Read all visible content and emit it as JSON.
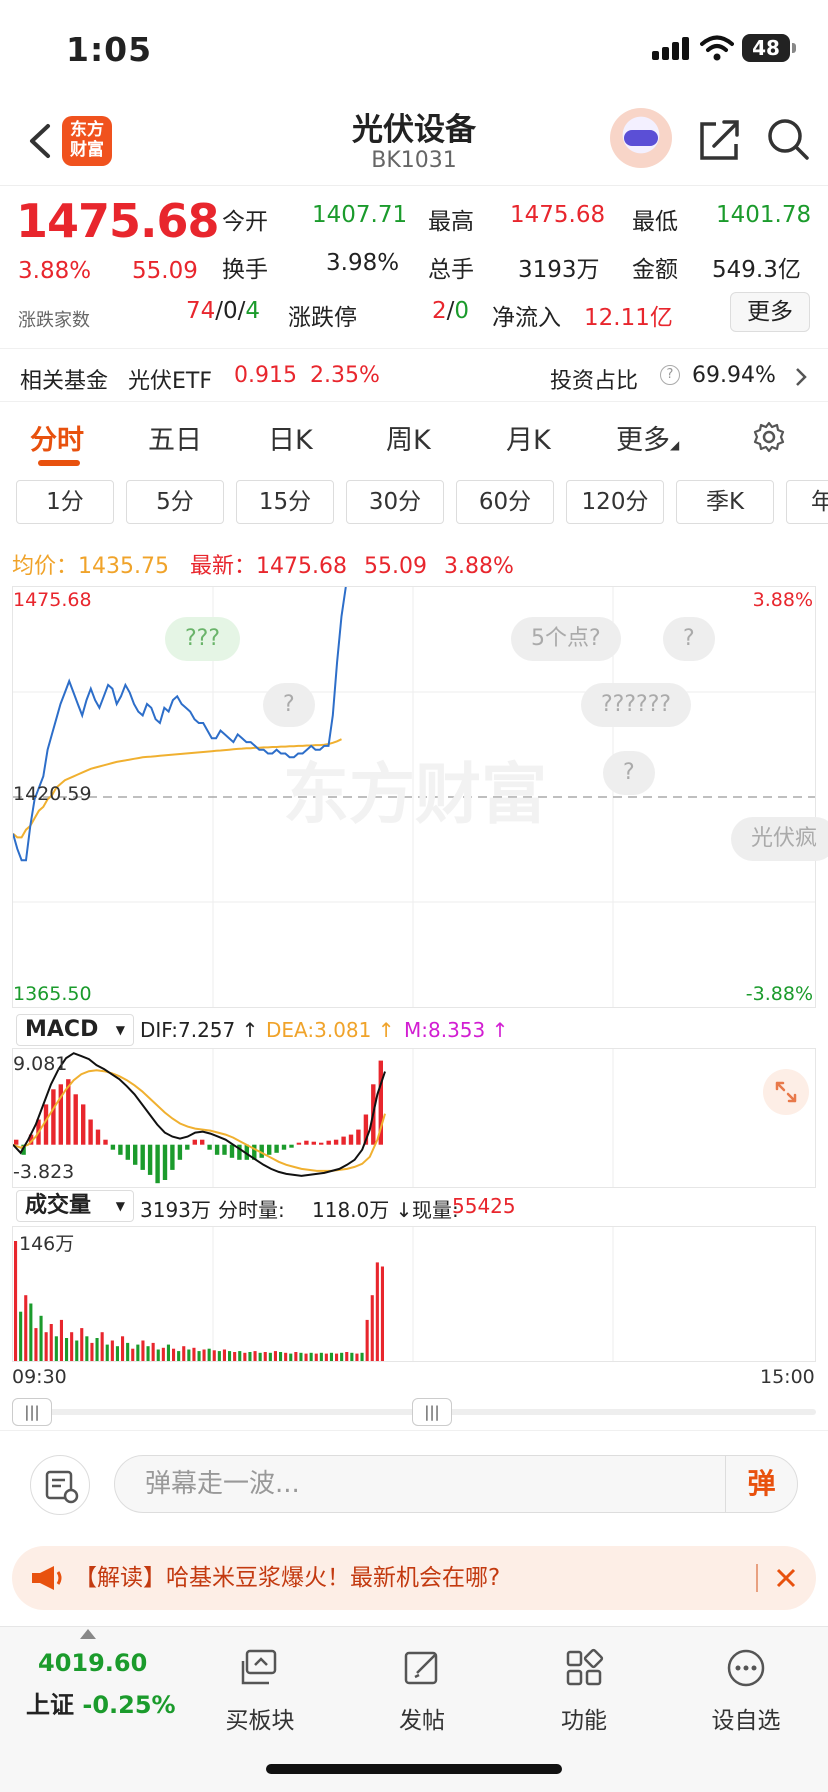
{
  "status": {
    "time": "1:05",
    "battery": "48"
  },
  "header": {
    "logo_text": "东方财富",
    "title": "光伏设备",
    "code": "BK1031"
  },
  "quote": {
    "price": "1475.68",
    "change_pct": "3.88%",
    "change": "55.09",
    "open_label": "今开",
    "open": "1407.71",
    "high_label": "最高",
    "high": "1475.68",
    "low_label": "最低",
    "low": "1401.78",
    "turnover_label": "换手",
    "turnover": "3.98%",
    "vol_label": "总手",
    "vol": "3193万",
    "amount_label": "金额",
    "amount": "549.3亿",
    "breadth_label": "涨跌家数",
    "up": "74",
    "flat": "0",
    "down": "4",
    "limit_label": "涨跌停",
    "limit_up": "2",
    "limit_down": "0",
    "inflow_label": "净流入",
    "inflow": "12.11亿",
    "more": "更多"
  },
  "fund": {
    "label": "相关基金",
    "name": "光伏ETF",
    "price": "0.915",
    "pct": "2.35%",
    "ratio_label": "投资占比",
    "ratio": "69.94%"
  },
  "tabs": [
    "分时",
    "五日",
    "日K",
    "周K",
    "月K",
    "更多"
  ],
  "periods": [
    "1分",
    "5分",
    "15分",
    "30分",
    "60分",
    "120分",
    "季K",
    "年"
  ],
  "avg": {
    "avg_label": "均价：",
    "avg": "1435.75",
    "latest_label": "最新：",
    "latest": "1475.68",
    "chg": "55.09",
    "pct": "3.88%"
  },
  "chart_data": {
    "type": "line",
    "y_top": "1475.68",
    "y_mid": "1420.59",
    "y_bottom": "1365.50",
    "pct_top": "3.88%",
    "pct_bottom": "-3.88%",
    "ylim": [
      1365.5,
      1475.68
    ],
    "x_start": "09:30",
    "x_end": "15:00",
    "series": [
      {
        "values": [
          1411,
          1407,
          1404,
          1404,
          1413,
          1420,
          1423,
          1426,
          1433,
          1437,
          1441,
          1445,
          1448,
          1451,
          1448,
          1445,
          1442,
          1446,
          1449,
          1446,
          1444,
          1447,
          1450,
          1449,
          1445,
          1447,
          1450,
          1448,
          1445,
          1443,
          1442,
          1445,
          1444,
          1441,
          1440,
          1444,
          1443,
          1446,
          1447,
          1445,
          1444,
          1443,
          1441,
          1440,
          1440,
          1438,
          1436,
          1436,
          1438,
          1437,
          1436,
          1435,
          1437,
          1436,
          1435,
          1435,
          1434,
          1433,
          1433,
          1432,
          1432,
          1433,
          1432,
          1432,
          1431,
          1431,
          1432,
          1432,
          1433,
          1434,
          1433,
          1433,
          1434,
          1434,
          1442,
          1456,
          1468,
          1475.68
        ]
      },
      {
        "values": [
          1411,
          1410,
          1410,
          1412,
          1413,
          1415,
          1417,
          1418,
          1420,
          1421,
          1423,
          1424,
          1425,
          1425.5,
          1426,
          1426.5,
          1427,
          1427.5,
          1428,
          1428.3,
          1428.6,
          1428.9,
          1429.2,
          1429.5,
          1429.8,
          1430,
          1430.2,
          1430.4,
          1430.6,
          1430.8,
          1431,
          1431.1,
          1431.2,
          1431.3,
          1431.4,
          1431.5,
          1431.6,
          1431.7,
          1431.8,
          1431.9,
          1432,
          1432.1,
          1432.2,
          1432.3,
          1432.4,
          1432.5,
          1432.6,
          1432.7,
          1432.8,
          1432.9,
          1433,
          1433.1,
          1433.2,
          1433.3,
          1433.4,
          1433.4,
          1433.5,
          1433.5,
          1433.6,
          1433.6,
          1433.7,
          1433.7,
          1433.8,
          1433.8,
          1433.9,
          1433.9,
          1434,
          1434,
          1434.1,
          1434.1,
          1434.2,
          1434.2,
          1434.3,
          1434.5,
          1434.8,
          1435.2,
          1435.75
        ]
      }
    ]
  },
  "bubbles": [
    "???",
    "5个点?",
    "?",
    "?",
    "??????",
    "?",
    "光伏疯"
  ],
  "watermark": "东方财富",
  "macd": {
    "select": "MACD",
    "dif": "DIF:7.257 ↑",
    "dea": "DEA:3.081 ↑",
    "m": "M:8.353 ↑",
    "y_top": "9.081",
    "y_bottom": "-3.823",
    "dif_series": [
      0,
      -0.8,
      0.5,
      2,
      4,
      6,
      7.5,
      8.6,
      9.081,
      8.8,
      8.5,
      7.9,
      7.5,
      7,
      6.5,
      5.8,
      5,
      4,
      3,
      2,
      1.2,
      0.8,
      0.6,
      0.8,
      1.2,
      1.3,
      1.1,
      0.8,
      0.5,
      0,
      -0.5,
      -1,
      -1.5,
      -2,
      -2.4,
      -2.7,
      -2.9,
      -3.0,
      -3.1,
      -3.0,
      -2.9,
      -2.8,
      -2.6,
      -2.4,
      -2,
      -1.5,
      -0.5,
      1.5,
      5,
      7.257
    ],
    "dea_series": [
      0,
      -0.3,
      0,
      0.8,
      2,
      3.2,
      4.4,
      5.5,
      6.4,
      7.0,
      7.3,
      7.4,
      7.3,
      7.1,
      6.8,
      6.4,
      5.9,
      5.3,
      4.6,
      3.9,
      3.2,
      2.6,
      2.1,
      1.8,
      1.6,
      1.5,
      1.4,
      1.2,
      1.0,
      0.7,
      0.3,
      -0.1,
      -0.5,
      -0.9,
      -1.3,
      -1.7,
      -2.0,
      -2.2,
      -2.4,
      -2.5,
      -2.6,
      -2.6,
      -2.6,
      -2.5,
      -2.4,
      -2.2,
      -1.9,
      -1.2,
      0.5,
      3.081
    ],
    "hist": [
      0.5,
      -1,
      1,
      2.5,
      4,
      5.5,
      6,
      6.5,
      5,
      4,
      2.5,
      1.5,
      0.5,
      -0.5,
      -1,
      -1.5,
      -2,
      -2.5,
      -3,
      -3.823,
      -3.5,
      -2.5,
      -1.5,
      -0.5,
      0.5,
      0.5,
      -0.5,
      -1,
      -1,
      -1.3,
      -1.5,
      -1.5,
      -1.5,
      -1.3,
      -1,
      -0.8,
      -0.5,
      -0.3,
      0.2,
      0.4,
      0.3,
      0.2,
      0.4,
      0.5,
      0.8,
      1,
      1.5,
      3,
      6,
      8.353
    ]
  },
  "volume": {
    "select": "成交量",
    "total": "3193万",
    "minute_label": "分时量:",
    "minute": "118.0万 ↓",
    "now_label": "现量:",
    "now": "55425",
    "y_top": "146万",
    "x_start": "09:30",
    "x_end": "15:00",
    "bars": [
      146,
      60,
      80,
      70,
      40,
      55,
      35,
      45,
      30,
      50,
      28,
      35,
      25,
      40,
      30,
      22,
      28,
      35,
      20,
      25,
      18,
      30,
      22,
      15,
      20,
      25,
      18,
      22,
      14,
      16,
      20,
      15,
      12,
      18,
      14,
      16,
      12,
      14,
      15,
      13,
      12,
      14,
      12,
      11,
      12,
      10,
      11,
      12,
      10,
      11,
      10,
      12,
      11,
      10,
      9,
      11,
      10,
      9,
      10,
      9,
      10,
      9,
      10,
      9,
      10,
      11,
      10,
      9,
      10,
      50,
      80,
      120,
      115
    ],
    "bar_colors": [
      "r",
      "g",
      "r",
      "g",
      "r",
      "g",
      "r",
      "r",
      "g",
      "r",
      "g",
      "r",
      "g",
      "r",
      "g",
      "r",
      "g",
      "r",
      "g",
      "r",
      "g",
      "r",
      "g",
      "r",
      "g",
      "r",
      "g",
      "r",
      "g",
      "r",
      "g",
      "r",
      "g",
      "r",
      "g",
      "r",
      "g",
      "r",
      "g",
      "r",
      "g",
      "r",
      "g",
      "r",
      "g",
      "r",
      "g",
      "r",
      "g",
      "r",
      "g",
      "r",
      "g",
      "r",
      "g",
      "r",
      "g",
      "r",
      "g",
      "r",
      "g",
      "r",
      "g",
      "r",
      "g",
      "r",
      "g",
      "r",
      "g",
      "r",
      "r",
      "r",
      "r"
    ]
  },
  "danmu": {
    "placeholder": "弹幕走一波...",
    "button": "弹"
  },
  "banner": {
    "text": "【解读】哈基米豆浆爆火！最新机会在哪?"
  },
  "nav": {
    "index_value": "4019.60",
    "index_name": "上证",
    "index_pct": "-0.25%",
    "items": [
      "买板块",
      "发帖",
      "功能",
      "设自选"
    ]
  }
}
